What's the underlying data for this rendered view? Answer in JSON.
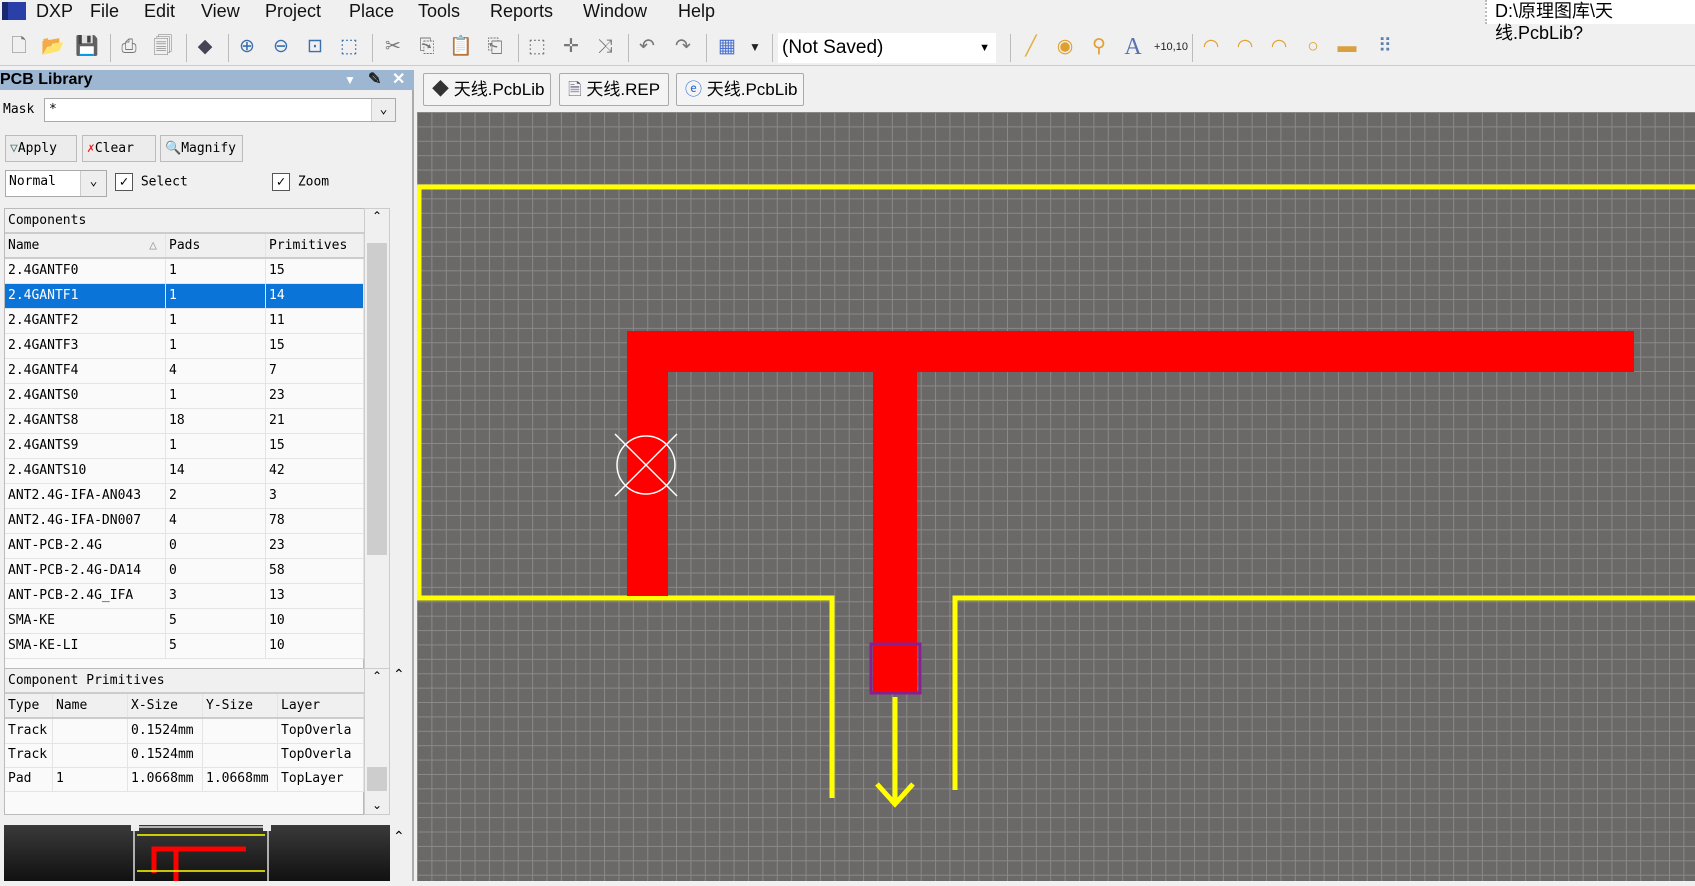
{
  "menubar": {
    "app": "DXP",
    "items": [
      "File",
      "Edit",
      "View",
      "Project",
      "Place",
      "Tools",
      "Reports",
      "Window",
      "Help"
    ],
    "path": "D:\\原理图库\\天线.PcbLib?"
  },
  "toolbar": {
    "icons": [
      "new-file",
      "open-folder",
      "save",
      "print",
      "print-preview",
      "layers",
      "zoom-in",
      "zoom-out",
      "zoom-fit",
      "zoom-area",
      "cut",
      "copy",
      "paste",
      "paste-special",
      "select-area",
      "move",
      "cross-select",
      "undo",
      "redo",
      "grid",
      "grid-dropdown"
    ],
    "variant": "(Not Saved)",
    "place_icons": [
      "line",
      "pad",
      "via",
      "string",
      "coordinate",
      "arc-center",
      "arc-edge",
      "arc-any",
      "full-circle",
      "fill",
      "array"
    ],
    "coord_label": "+10,10"
  },
  "panel": {
    "title": "PCB Library",
    "mask_label": "Mask",
    "mask_value": "*",
    "apply": "Apply",
    "clear": "Clear",
    "magnify": "Magnify",
    "mode": "Normal",
    "select": "Select",
    "zoom": "Zoom",
    "components": {
      "title": "Components",
      "headers": [
        "Name",
        "Pads",
        "Primitives"
      ],
      "rows": [
        [
          "2.4GANTF0",
          "1",
          "15"
        ],
        [
          "2.4GANTF1",
          "1",
          "14"
        ],
        [
          "2.4GANTF2",
          "1",
          "11"
        ],
        [
          "2.4GANTF3",
          "1",
          "15"
        ],
        [
          "2.4GANTF4",
          "4",
          "7"
        ],
        [
          "2.4GANTS0",
          "1",
          "23"
        ],
        [
          "2.4GANTS8",
          "18",
          "21"
        ],
        [
          "2.4GANTS9",
          "1",
          "15"
        ],
        [
          "2.4GANTS10",
          "14",
          "42"
        ],
        [
          "ANT2.4G-IFA-AN043",
          "2",
          "3"
        ],
        [
          "ANT2.4G-IFA-DN007",
          "4",
          "78"
        ],
        [
          "ANT-PCB-2.4G",
          "0",
          "23"
        ],
        [
          "ANT-PCB-2.4G-DA14",
          "0",
          "58"
        ],
        [
          "ANT-PCB-2.4G_IFA",
          "3",
          "13"
        ],
        [
          "SMA-KE",
          "5",
          "10"
        ],
        [
          "SMA-KE-LI",
          "5",
          "10"
        ]
      ],
      "selected": 1
    },
    "primitives": {
      "title": "Component Primitives",
      "headers": [
        "Type",
        "Name",
        "X-Size",
        "Y-Size",
        "Layer"
      ],
      "rows": [
        [
          "Track",
          "",
          "0.1524mm",
          "",
          "TopOverla"
        ],
        [
          "Track",
          "",
          "0.1524mm",
          "",
          "TopOverla"
        ],
        [
          "Pad",
          "1",
          "1.0668mm",
          "1.0668mm",
          "TopLayer"
        ]
      ]
    }
  },
  "tabs": [
    "天线.PcbLib",
    "天线.REP",
    "天线.PcbLib"
  ],
  "colors": {
    "track": "#ff0000",
    "overlay": "#ffff00",
    "grid_bg": "#6b6868",
    "selection": "#0a74d8"
  }
}
